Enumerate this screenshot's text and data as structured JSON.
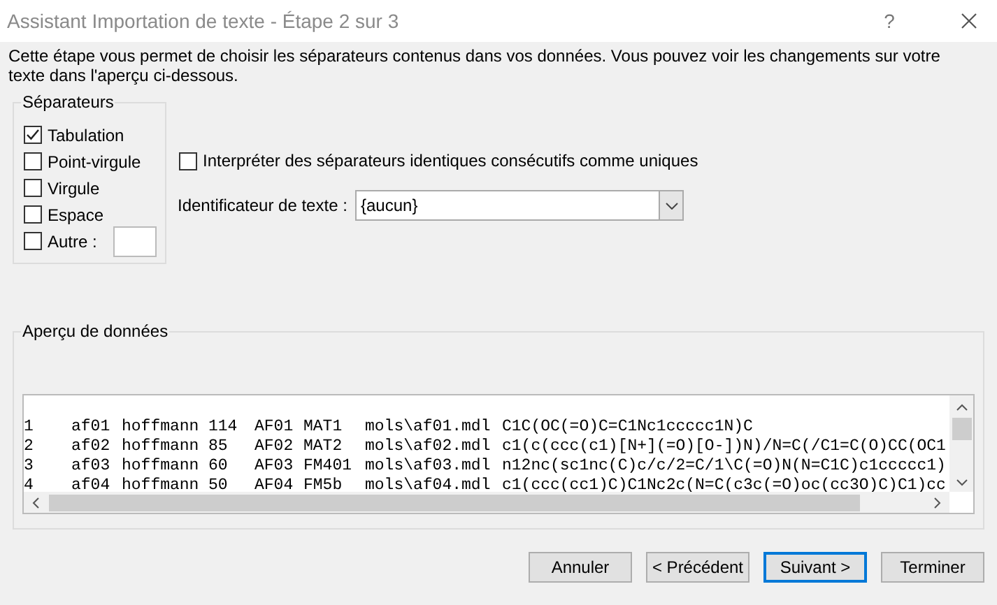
{
  "window": {
    "title": "Assistant Importation de texte - Étape 2 sur 3",
    "help": "?"
  },
  "description": "Cette étape vous permet de choisir les séparateurs contenus dans vos données. Vous pouvez voir les changements sur votre texte dans l'aperçu ci-dessous.",
  "separators": {
    "title": "Séparateurs",
    "items": [
      {
        "label": "Tabulation",
        "checked": true
      },
      {
        "label": "Point-virgule",
        "checked": false
      },
      {
        "label": "Virgule",
        "checked": false
      },
      {
        "label": "Espace",
        "checked": false
      },
      {
        "label": "Autre :",
        "checked": false,
        "kind": "other"
      }
    ]
  },
  "consecutive": {
    "label": "Interpréter des séparateurs identiques consécutifs comme uniques",
    "checked": false
  },
  "text_qualifier": {
    "label": "Identificateur de texte :",
    "value": "{aucun}"
  },
  "preview": {
    "title": "Aperçu de données",
    "rows": [
      [
        "1",
        "af01",
        "hoffmann",
        "114",
        "AF01",
        "MAT1",
        "mols\\af01.mdl",
        "C1C(OC(=O)C=C1Nc1ccccc1N)C"
      ],
      [
        "2",
        "af02",
        "hoffmann",
        "85",
        "AF02",
        "MAT2",
        "mols\\af02.mdl",
        "c1(c(ccc(c1)[N+](=O)[O-])N)/N=C(/C1=C(O)CC(OC1"
      ],
      [
        "3",
        "af03",
        "hoffmann",
        "60",
        "AF03",
        "FM401",
        "mols\\af03.mdl",
        "n12nc(sc1nc(C)c/c/2=C/1\\C(=O)N(N=C1C)c1ccccc1)"
      ],
      [
        "4",
        "af04",
        "hoffmann",
        "50",
        "AF04",
        "FM5b",
        "mols\\af04.mdl",
        "c1(ccc(cc1)C)C1Nc2c(N=C(c3c(=O)oc(cc3O)C)C1)cc"
      ]
    ]
  },
  "buttons": [
    {
      "label": "Annuler",
      "selected": false
    },
    {
      "label": "< Précédent",
      "selected": false
    },
    {
      "label": "Suivant >",
      "selected": true
    },
    {
      "label": "Terminer",
      "selected": false
    }
  ]
}
